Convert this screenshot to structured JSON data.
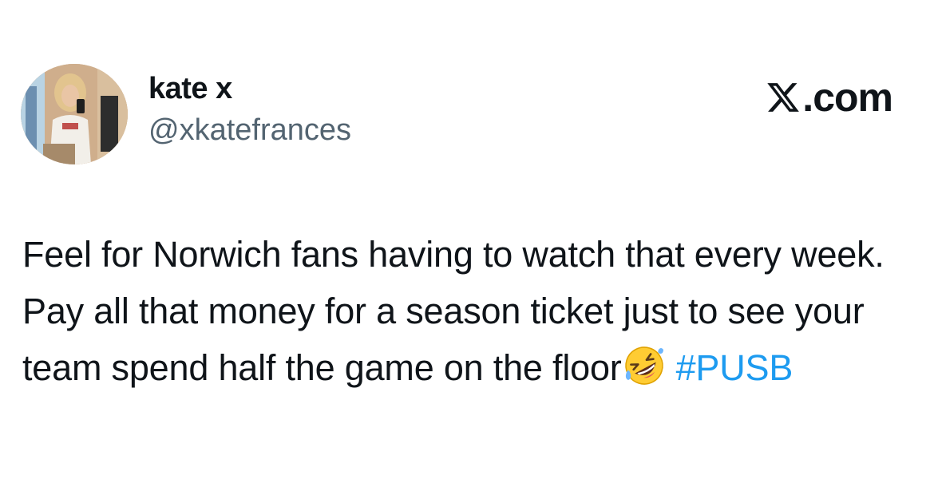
{
  "author": {
    "display_name": "kate x",
    "handle": "@xkatefrances",
    "avatar_icon": "profile-photo"
  },
  "brand": {
    "icon": "x-logo-icon",
    "text": ".com"
  },
  "tweet": {
    "text_before_emoji": "Feel for Norwich fans having to watch that every week. Pay all that money for a season ticket just to see your team spend half the game on the floor",
    "emoji_icon": "rolling-on-floor-laughing-emoji",
    "hashtag": "#PUSB"
  },
  "colors": {
    "text": "#0f1419",
    "muted": "#536471",
    "link": "#1d9bf0",
    "background": "#ffffff"
  }
}
